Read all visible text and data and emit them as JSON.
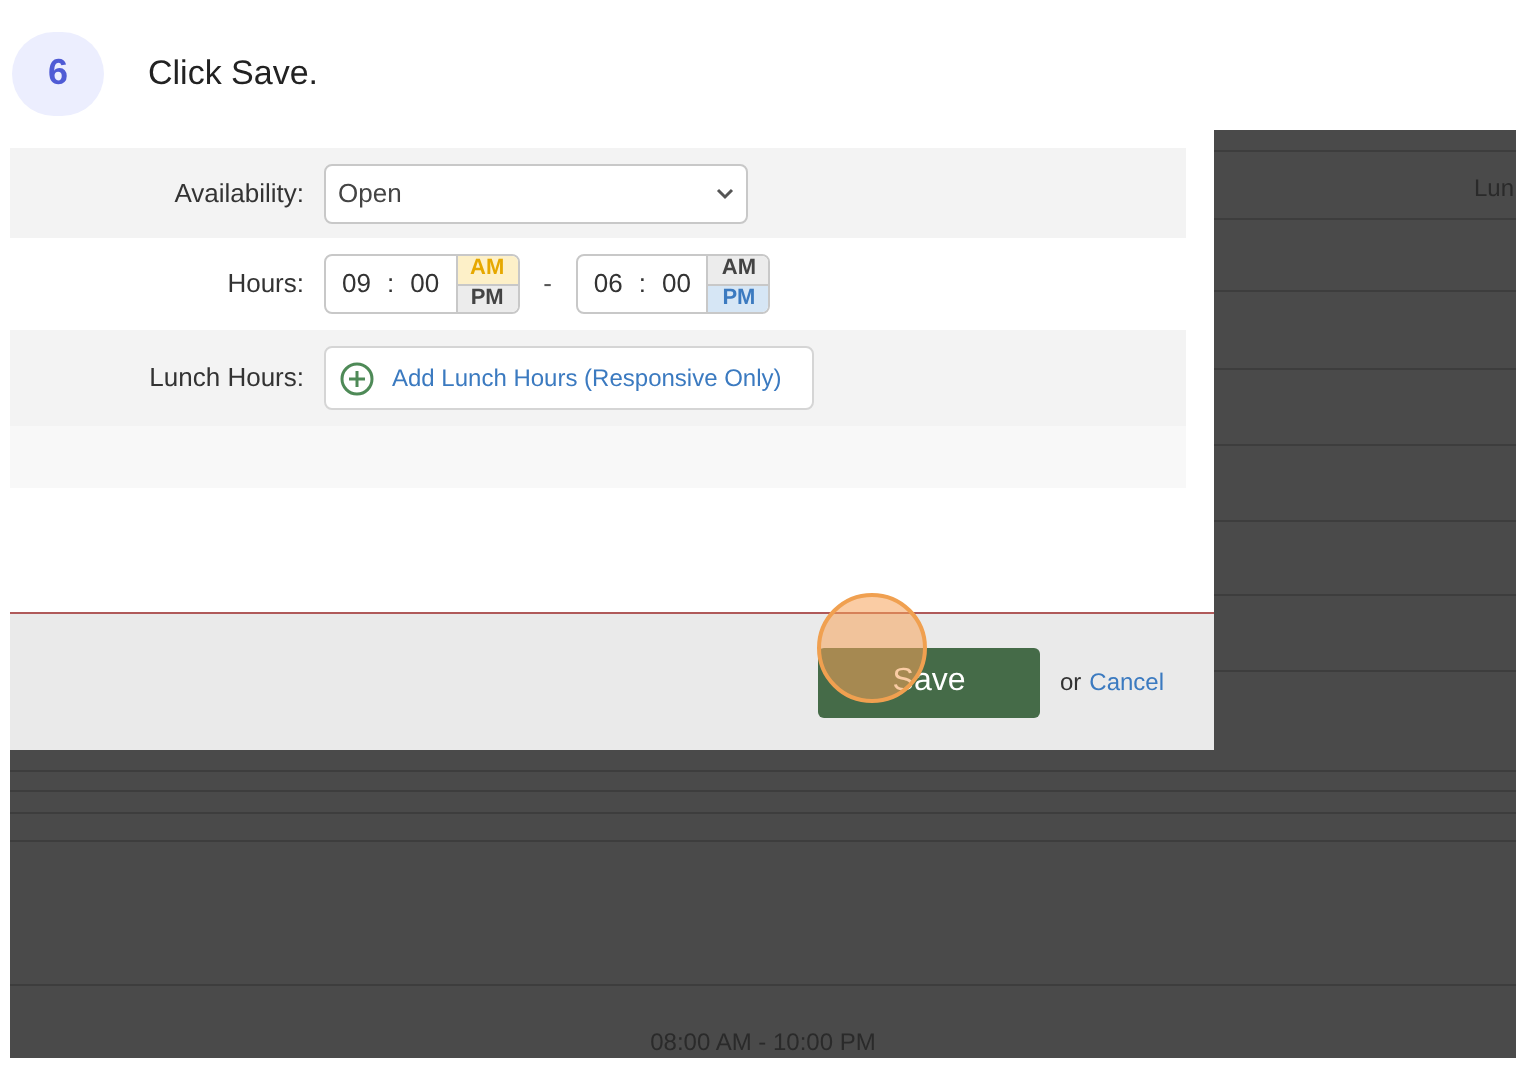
{
  "step": {
    "number": "6",
    "instruction": "Click Save."
  },
  "background": {
    "column_label": "Lun",
    "hours_text": "08:00 AM - 10:00 PM"
  },
  "form": {
    "availability": {
      "label": "Availability:",
      "value": "Open"
    },
    "hours": {
      "label": "Hours:",
      "separator": "-",
      "times": [
        {
          "hour": "09",
          "colon": ":",
          "minute": "00",
          "periods": [
            {
              "label": "AM",
              "selected": true
            },
            {
              "label": "PM",
              "selected": false
            }
          ]
        },
        {
          "hour": "06",
          "colon": ":",
          "minute": "00",
          "periods": [
            {
              "label": "AM",
              "selected": false
            },
            {
              "label": "PM",
              "selected": true
            }
          ]
        }
      ]
    },
    "lunch": {
      "label": "Lunch Hours:",
      "button": "Add Lunch Hours (Responsive Only)"
    }
  },
  "footer": {
    "save": "Save",
    "or": "or",
    "cancel": "Cancel"
  }
}
